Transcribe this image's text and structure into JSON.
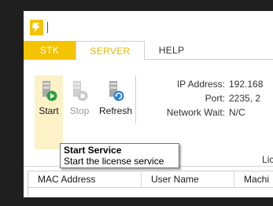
{
  "tabs": [
    {
      "label": "STK"
    },
    {
      "label": "SERVER"
    },
    {
      "label": "HELP"
    }
  ],
  "active_tab": "SERVER",
  "ribbon": {
    "start_label": "Start",
    "stop_label": "Stop",
    "refresh_label": "Refresh"
  },
  "server_info": {
    "ip_label": "IP Address:",
    "ip_value": "192.168",
    "port_label": "Port:",
    "port_value": "2235, 2",
    "network_wait_label": "Network Wait:",
    "network_wait_value": "N/C"
  },
  "tooltip": {
    "title": "Start Service",
    "description": "Start the license service"
  },
  "license_panel_label": "Lic",
  "table": {
    "columns": [
      "MAC Address",
      "User Name",
      "Machi"
    ],
    "rows": []
  },
  "colors": {
    "accent": "#f5c400",
    "frame": "#1f1f1f",
    "start_highlight": "#fdf1c7"
  },
  "icons": {
    "app_logo": "app-logo-icon",
    "start": "start-play-icon",
    "stop": "stop-icon",
    "refresh": "refresh-icon"
  }
}
